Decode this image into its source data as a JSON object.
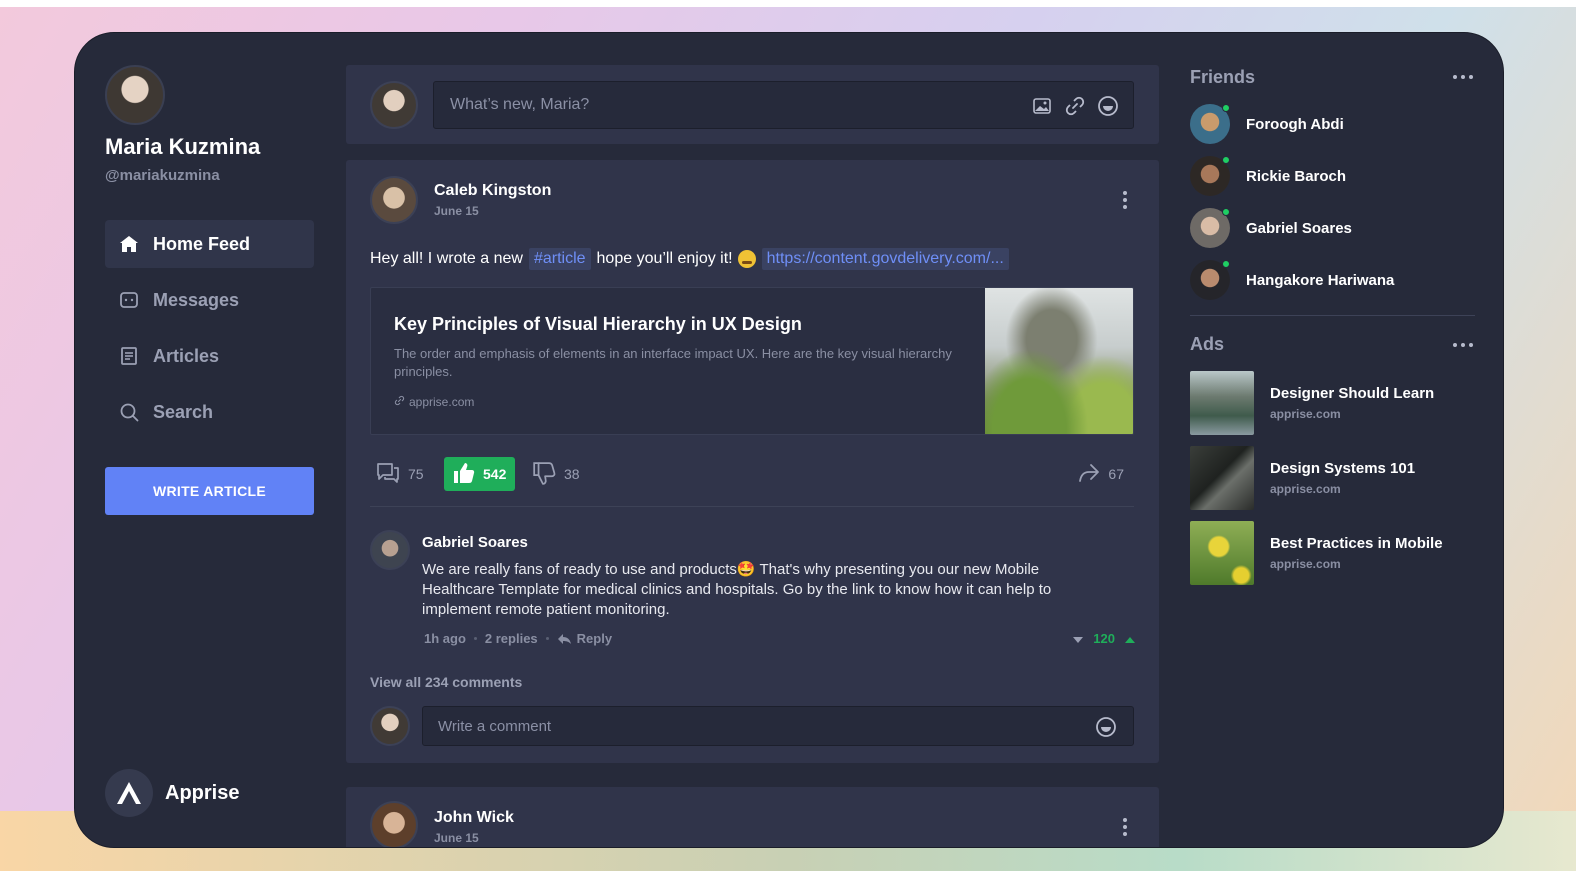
{
  "user": {
    "name": "Maria Kuzmina",
    "handle": "@mariakuzmina"
  },
  "nav": {
    "items": [
      {
        "label": "Home Feed",
        "icon": "home-icon",
        "active": true
      },
      {
        "label": "Messages",
        "icon": "messages-icon",
        "active": false
      },
      {
        "label": "Articles",
        "icon": "articles-icon",
        "active": false
      },
      {
        "label": "Search",
        "icon": "search-icon",
        "active": false
      }
    ],
    "write_button": "WRITE ARTICLE"
  },
  "brand": {
    "name": "Apprise"
  },
  "composer": {
    "placeholder": "What’s new, Maria?",
    "icons": [
      "image-icon",
      "link-icon",
      "emoji-icon"
    ]
  },
  "post": {
    "author": "Caleb Kingston",
    "date": "June 15",
    "text_before": "Hey all! I wrote a new",
    "hashtag": "#article",
    "text_after": "hope you’ll enjoy it!",
    "url": "https://content.govdelivery.com/...",
    "article": {
      "title": "Key Principles of Visual Hierarchy in UX Design",
      "description": "The order and emphasis of elements in an interface impact UX. Here are the key visual hierarchy principles.",
      "source": "apprise.com"
    },
    "stats": {
      "comments": "75",
      "likes": "542",
      "dislikes": "38",
      "shares": "67"
    },
    "comment": {
      "author": "Gabriel Soares",
      "text": "We are really fans of ready to use and products🤩 That's why presenting you our new Mobile Healthcare Template for medical clinics and hospitals. Go by the link to know how it can help to implement remote patient monitoring.",
      "time": "1h ago",
      "replies": "2 replies",
      "reply_label": "Reply",
      "votes": "120"
    },
    "view_all": "View all 234 comments",
    "comment_placeholder": "Write a comment"
  },
  "post2": {
    "author": "John Wick",
    "date": "June 15"
  },
  "friends": {
    "title": "Friends",
    "items": [
      {
        "name": "Foroogh Abdi",
        "online": true
      },
      {
        "name": "Rickie Baroch",
        "online": true
      },
      {
        "name": "Gabriel Soares",
        "online": true
      },
      {
        "name": "Hangakore Hariwana",
        "online": true
      }
    ]
  },
  "ads": {
    "title": "Ads",
    "items": [
      {
        "title": "Designer Should Learn",
        "source": "apprise.com"
      },
      {
        "title": "Design Systems 101",
        "source": "apprise.com"
      },
      {
        "title": "Best Practices in Mobile",
        "source": "apprise.com"
      }
    ]
  },
  "colors": {
    "accent": "#6182f6",
    "like": "#1fae5a",
    "online": "#1fce63",
    "panel": "#30344a",
    "app_bg": "#262a3a"
  }
}
